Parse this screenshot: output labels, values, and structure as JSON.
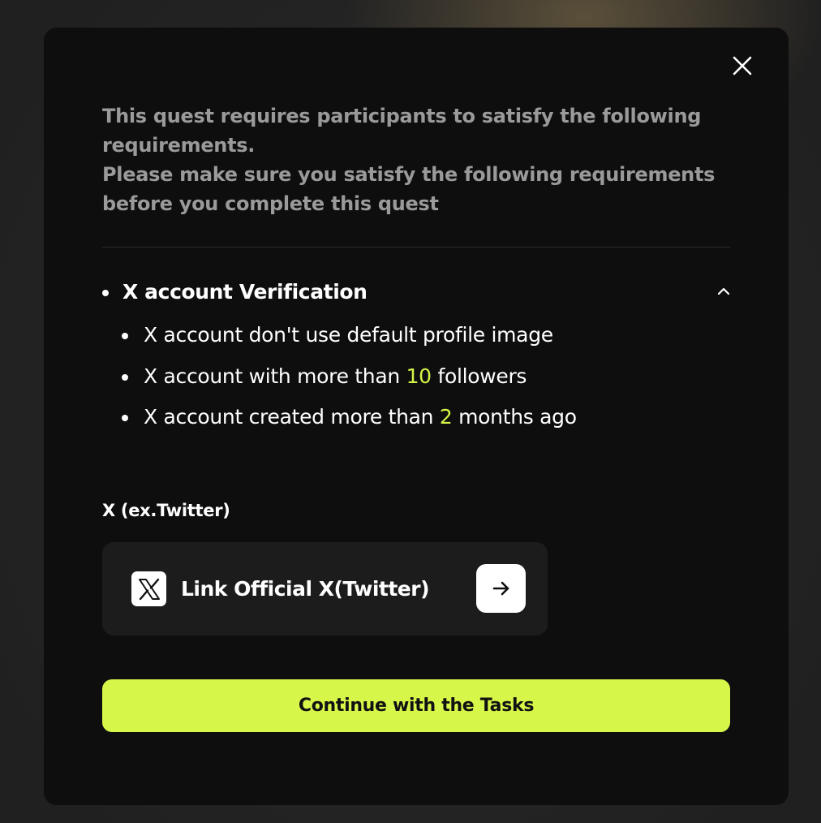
{
  "modal": {
    "close_icon": "close-icon",
    "intro_line1": "This quest requires participants to satisfy the following requirements.",
    "intro_line2": "Please make sure you satisfy the following requirements before you complete this quest"
  },
  "verification": {
    "title": "X account Verification",
    "expanded": true,
    "toggle_icon": "chevron-up-icon",
    "requirements": [
      {
        "prefix": "X account don't use default profile image",
        "value": "",
        "suffix": ""
      },
      {
        "prefix": "X account with more than ",
        "value": "10",
        "suffix": " followers"
      },
      {
        "prefix": "X account created more than ",
        "value": "2",
        "suffix": " months ago"
      }
    ]
  },
  "social": {
    "section_label": "X (ex.Twitter)",
    "link_label": "Link Official X(Twitter)",
    "logo_icon": "x-logo-icon",
    "action_icon": "arrow-right-icon"
  },
  "actions": {
    "continue_label": "Continue with the Tasks"
  },
  "colors": {
    "accent": "#d6f74a",
    "highlight_text": "#d4f547",
    "modal_bg": "#0e0e0e",
    "card_bg": "#1c1c1c",
    "muted_text": "#9a9a9a"
  }
}
